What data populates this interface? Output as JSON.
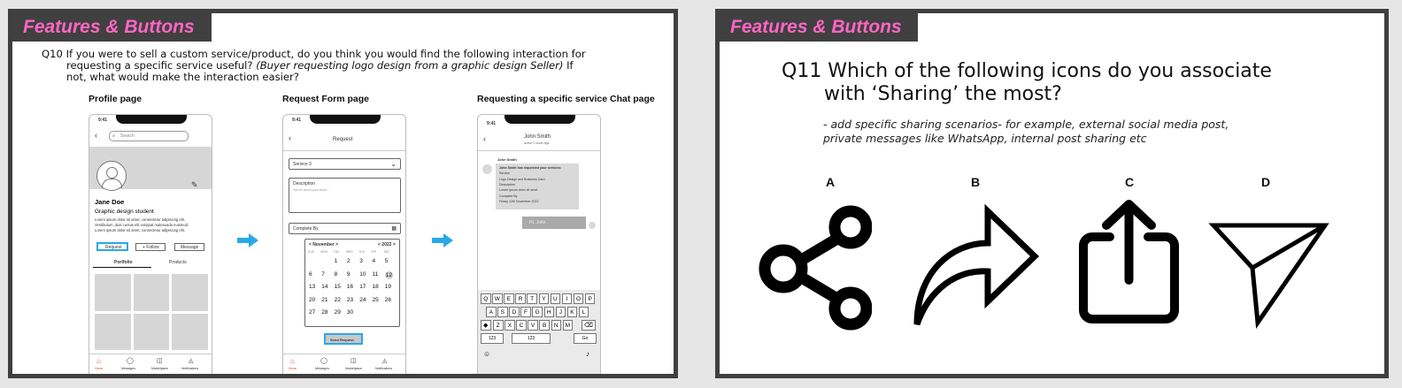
{
  "slide1": {
    "banner": "Features & Buttons",
    "question_line1": "Q10 If you were to sell a custom service/product, do you think you would find the following interaction for",
    "question_line2_plain": "requesting a specific service useful? ",
    "question_line2_italic": "(Buyer requesting logo design from a graphic design Seller)",
    "question_line2_end": " If",
    "question_line3": "not, what would make the interaction easier?",
    "labels": [
      "Profile page",
      "Request Form page",
      "Requesting a specific service Chat page"
    ],
    "profile": {
      "time": "9:41",
      "search_placeholder": "Search",
      "name": "Jane Doe",
      "subtitle": "Graphic design student",
      "bio": "Lorem ipsum dolor sit amet, consectetur adipiscing elit. Vestibulum, duis cursus elit volutpat malesuada euismod. Lorem ipsum dolor sit amet, consectetur adipiscing elit.",
      "buttons": [
        "Request",
        "+ Follow",
        "Message"
      ],
      "tabs": [
        "Portfolio",
        "Products"
      ],
      "nav": [
        "Home",
        "Messages",
        "Marketplace",
        "Notifications"
      ]
    },
    "request": {
      "time": "9:41",
      "title": "Request",
      "service": "Service 3",
      "description_label": "Description",
      "description_placeholder": "Tell me about your ideas...",
      "complete_by": "Complete By",
      "month": "< November >",
      "year": "< 2022 >",
      "weekdays": [
        "SUN",
        "MON",
        "TUE",
        "WED",
        "THU",
        "FRI",
        "SAT"
      ],
      "weeks": [
        [
          "",
          "",
          "1",
          "2",
          "3",
          "4",
          "5"
        ],
        [
          "6",
          "7",
          "8",
          "9",
          "10",
          "11",
          "12"
        ],
        [
          "13",
          "14",
          "15",
          "16",
          "17",
          "18",
          "19"
        ],
        [
          "20",
          "21",
          "22",
          "23",
          "24",
          "25",
          "26"
        ],
        [
          "27",
          "28",
          "29",
          "30",
          "",
          "",
          ""
        ]
      ],
      "selected_day": "12",
      "send_button": "Send Request",
      "nav": [
        "Home",
        "Messages",
        "Marketplace",
        "Notifications"
      ]
    },
    "chat": {
      "time": "9:41",
      "contact": "John Smith",
      "status": "active 2 hours ago",
      "sender": "John Smith",
      "message_lines": [
        "John Smith has requested your services:",
        "Service",
        "Logo Design and Business Card",
        "Description",
        "Lorem ipsum dolor sit amet",
        "Complete By",
        "Friday 12th November 2022"
      ],
      "reply": "Hi, John.",
      "keyboard_rows": [
        [
          "Q",
          "W",
          "E",
          "R",
          "T",
          "Y",
          "U",
          "I",
          "O",
          "P"
        ],
        [
          "A",
          "S",
          "D",
          "F",
          "G",
          "H",
          "J",
          "K",
          "L"
        ],
        [
          "Z",
          "X",
          "C",
          "V",
          "B",
          "N",
          "M"
        ]
      ],
      "bottom_keys": [
        "123",
        "123",
        "Go"
      ]
    }
  },
  "slide2": {
    "banner": "Features & Buttons",
    "question_line1": "Q11 Which of the following icons do you associate",
    "question_line2": "with ‘Sharing’ the most?",
    "note_line1": "- add specific sharing scenarios- for example, external social media post,",
    "note_line2": "private messages like WhatsApp, internal post sharing etc",
    "options": [
      "A",
      "B",
      "C",
      "D"
    ],
    "icons": [
      "share-nodes-icon",
      "forward-arrow-icon",
      "upload-box-icon",
      "paper-plane-icon"
    ]
  }
}
